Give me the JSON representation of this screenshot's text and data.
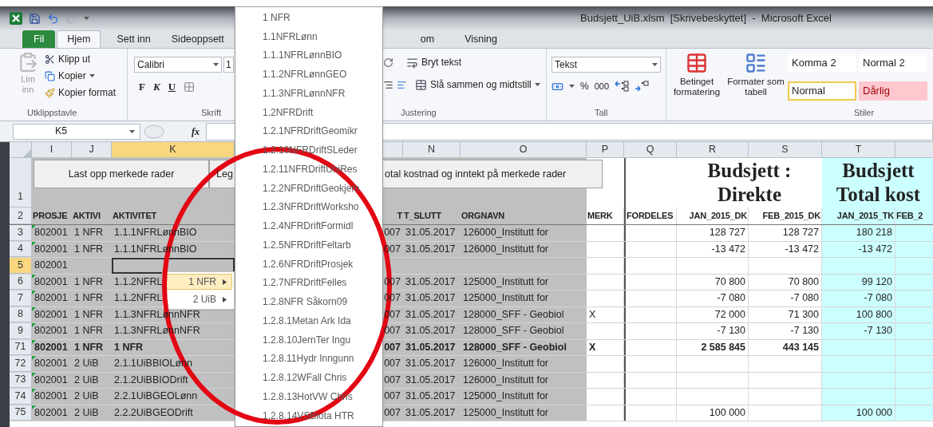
{
  "window": {
    "title": "Budsjett_UiB.xlsm  [Skrivebeskyttet]  -  Microsoft Excel"
  },
  "ribbon_tabs": [
    {
      "label": "Fil",
      "kind": "file",
      "selected": false
    },
    {
      "label": "Hjem",
      "kind": "tab",
      "selected": true
    },
    {
      "label": "Sett inn",
      "kind": "tab",
      "selected": false
    },
    {
      "label": "Sideoppsett",
      "kind": "tab",
      "selected": false
    },
    {
      "label": "om",
      "kind": "tab",
      "selected": false
    },
    {
      "label": "Visning",
      "kind": "tab",
      "selected": false
    }
  ],
  "ribbon": {
    "clipboard": {
      "paste": "Lim inn",
      "paste_disabled": true,
      "cut": "Klipp ut",
      "copy": "Kopier",
      "format_painter": "Kopier format",
      "label": "Utklippstavle"
    },
    "font": {
      "name": "Calibri",
      "size": "1",
      "bold": "F",
      "italic": "K",
      "underline": "U",
      "label": "Skrift"
    },
    "alignment": {
      "wrap": "Bryt tekst",
      "merge": "Slå sammen og midtstill",
      "label": "Justering"
    },
    "number": {
      "format": "Tekst",
      "percent": "%",
      "thousands": "000",
      "label": "Tall"
    },
    "styles": {
      "conditional": "Betinget formatering",
      "as_table": "Formater som tabell",
      "label": "Stiler",
      "gallery": [
        {
          "label": "Komma 2",
          "kind": "plain",
          "selected": false
        },
        {
          "label": "Normal 2",
          "kind": "plain",
          "selected": false
        },
        {
          "label": "Normal",
          "kind": "plain",
          "selected": true
        },
        {
          "label": "Dårlig",
          "kind": "bad",
          "selected": false
        }
      ]
    }
  },
  "formula_bar": {
    "name_box": "K5",
    "function_label": "fx"
  },
  "columns": [
    {
      "letter": "I",
      "selected": false
    },
    {
      "letter": "J",
      "selected": false
    },
    {
      "letter": "K",
      "selected": true
    },
    {
      "letter": "N",
      "selected": false
    },
    {
      "letter": "O",
      "selected": false
    },
    {
      "letter": "P",
      "selected": false
    },
    {
      "letter": "Q",
      "selected": false
    },
    {
      "letter": "R",
      "selected": false
    },
    {
      "letter": "S",
      "selected": false
    },
    {
      "letter": "T",
      "selected": false
    }
  ],
  "title_row": {
    "number": "1",
    "buttons": [
      "Last opp merkede rader",
      "Leg",
      "otal kostnad og inntekt på merkede rader"
    ],
    "headings": [
      "Budsjett : Direkte",
      "Budsjett Total kost"
    ]
  },
  "header_row": {
    "number": "2",
    "cells": [
      "PROSJE",
      "AKTIVI",
      "AKTIVITET",
      "T",
      "T_SLUTT",
      "ORGNAVN",
      "MERK",
      "FORDELES",
      "JAN_2015_DK",
      "FEB_2015_DK",
      "JAN_2015_TK",
      "FEB_2"
    ]
  },
  "rows": [
    {
      "number": "3",
      "selected": false,
      "bold": false,
      "error_flag": true,
      "cells": [
        "802001",
        "1 NFR",
        "1.1.1NFRLønnBIO",
        "007",
        "31.05.2017",
        "126000_Institutt for",
        "",
        "",
        "128 727",
        "128 727",
        "180 218",
        ""
      ]
    },
    {
      "number": "4",
      "selected": false,
      "bold": false,
      "error_flag": true,
      "cells": [
        "802001",
        "1 NFR",
        "1.1.1NFRLønnBIO",
        "007",
        "31.05.2017",
        "126000_Institutt for",
        "",
        "",
        "-13 472",
        "-13 472",
        "-13 472",
        ""
      ]
    },
    {
      "number": "5",
      "selected": true,
      "bold": false,
      "error_flag": false,
      "cells": [
        "802001",
        "",
        "",
        "",
        "",
        "",
        "",
        "",
        "",
        "",
        "",
        ""
      ]
    },
    {
      "number": "6",
      "selected": false,
      "bold": false,
      "error_flag": true,
      "cells": [
        "802001",
        "1 NFR",
        "1.1.2NFRL",
        "007",
        "31.05.2017",
        "125000_Institutt for",
        "",
        "",
        "70 800",
        "70 800",
        "99 120",
        ""
      ]
    },
    {
      "number": "7",
      "selected": false,
      "bold": false,
      "error_flag": true,
      "cells": [
        "802001",
        "1 NFR",
        "1.1.2NFRL",
        "007",
        "31.05.2017",
        "125000_Institutt for",
        "",
        "",
        "-7 080",
        "-7 080",
        "-7 080",
        ""
      ]
    },
    {
      "number": "8",
      "selected": false,
      "bold": false,
      "error_flag": true,
      "cells": [
        "802001",
        "1 NFR",
        "1.1.3NFRLønnNFR",
        "007",
        "31.05.2017",
        "128000_SFF - Geobiol",
        "X",
        "",
        "72 000",
        "71 300",
        "100 800",
        ""
      ]
    },
    {
      "number": "9",
      "selected": false,
      "bold": false,
      "error_flag": true,
      "cells": [
        "802001",
        "1 NFR",
        "1.1.3NFRLønnNFR",
        "007",
        "31.05.2017",
        "128000_SFF - Geobiol",
        "",
        "",
        "-7 130",
        "-7 130",
        "-7 130",
        ""
      ]
    },
    {
      "number": "71",
      "selected": false,
      "bold": true,
      "error_flag": true,
      "cells": [
        "802001",
        "1 NFR",
        "1 NFR",
        "007",
        "31.05.2017",
        "128000_SFF - Geobiol",
        "X",
        "",
        "2 585 845",
        "443 145",
        "",
        ""
      ]
    },
    {
      "number": "72",
      "selected": false,
      "bold": false,
      "error_flag": true,
      "cells": [
        "802001",
        "2 UiB",
        "2.1.1UiBBIOLønn",
        "007",
        "31.05.2017",
        "126000_Institutt for",
        "",
        "",
        "",
        "",
        "",
        ""
      ]
    },
    {
      "number": "73",
      "selected": false,
      "bold": false,
      "error_flag": true,
      "cells": [
        "802001",
        "2 UiB",
        "2.1.2UiBBIODrift",
        "007",
        "31.05.2017",
        "126000_Institutt for",
        "",
        "",
        "",
        "",
        "",
        ""
      ]
    },
    {
      "number": "74",
      "selected": false,
      "bold": false,
      "error_flag": true,
      "cells": [
        "802001",
        "2 UiB",
        "2.2.1UiBGEOLønn",
        "007",
        "31.05.2017",
        "125000_Institutt for",
        "",
        "",
        "",
        "",
        "",
        ""
      ]
    },
    {
      "number": "75",
      "selected": false,
      "bold": false,
      "error_flag": true,
      "cells": [
        "802001",
        "2 UiB",
        "2.2.2UiBGEODrift",
        "007",
        "31.05.2017",
        "125000_Institutt for",
        "",
        "",
        "100 000",
        "",
        "100 000",
        ""
      ]
    }
  ],
  "context_menu": [
    {
      "label": "1 NFR",
      "selected": true
    },
    {
      "label": "2 UiB",
      "selected": false
    }
  ],
  "dropdown": [
    "1 NFR",
    "1.1NFRLønn",
    "1.1.1NFRLønnBIO",
    "1.1.2NFRLønnGEO",
    "1.1.3NFRLønnNFR",
    "1.2NFRDrift",
    "1.2.1NFRDriftGeomikr",
    "1.2.10NFRDriftSLeder",
    "1.2.11NFRDriftUniRes",
    "1.2.2NFRDriftGeokjem",
    "1.2.3NFRDriftWorksho",
    "1.2.4NFRDriftFormidl",
    "1.2.5NFRDriftFeltarb",
    "1.2.6NFRDriftProsjek",
    "1.2.7NFRDriftFelles",
    "1.2.8NFR Såkorn09",
    "1.2.8.1Metan Ark Ida",
    "1.2.8.10JernTer Ingu",
    "1.2.8.11Hydr Inngunn",
    "1.2.8.12WFall Chris",
    "1.2.8.13HotVW Chris",
    "1.2.8.14VSBiota HTR"
  ]
}
